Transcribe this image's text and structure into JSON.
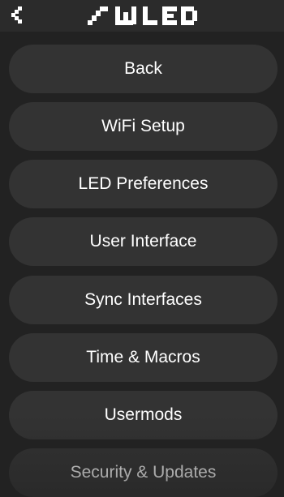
{
  "header": {
    "back_icon": "chevron-left-icon",
    "logo": "WLED"
  },
  "menu": {
    "items": [
      {
        "label": "Back"
      },
      {
        "label": "WiFi Setup"
      },
      {
        "label": "LED Preferences"
      },
      {
        "label": "User Interface"
      },
      {
        "label": "Sync Interfaces"
      },
      {
        "label": "Time & Macros"
      },
      {
        "label": "Usermods"
      },
      {
        "label": "Security & Updates"
      }
    ]
  },
  "colors": {
    "background": "#222222",
    "button": "#333333",
    "text": "#ffffff"
  }
}
